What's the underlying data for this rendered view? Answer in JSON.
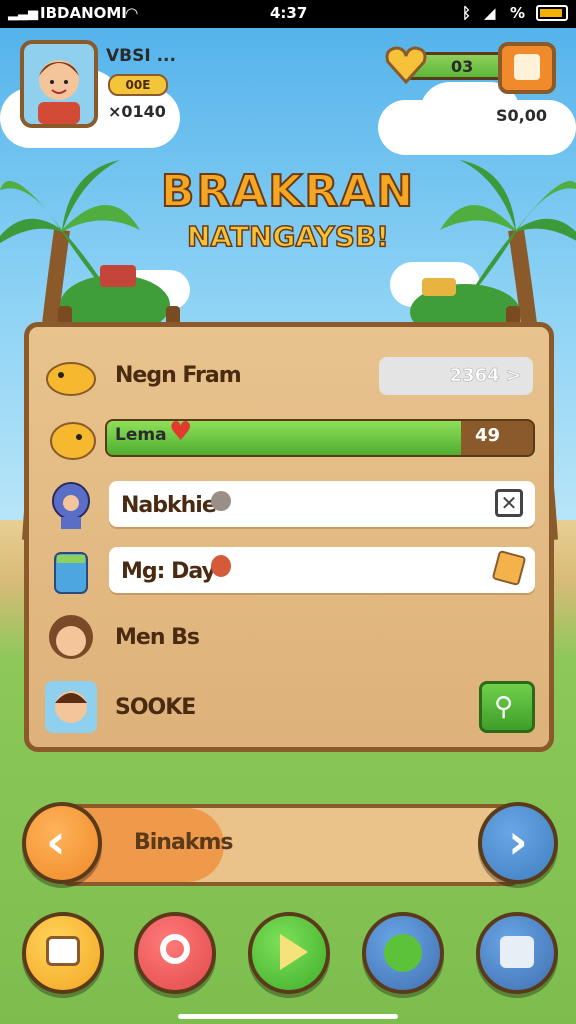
{
  "status_bar": {
    "carrier": "IBDANOMI",
    "time": "4:37",
    "battery_text": "%"
  },
  "player": {
    "name": "VBSI ...",
    "level": "00E",
    "coins": "×0140"
  },
  "currency": {
    "count": "03",
    "gold": "S0,00"
  },
  "title": {
    "line1": "BRAKRAN",
    "line2": "NATNGAYSB!"
  },
  "menu": {
    "row1": {
      "label": "Negn Fram",
      "value": "2364 >"
    },
    "row2": {
      "label": "Lema",
      "value": "49",
      "progress": 0.83
    },
    "row3": {
      "label": "Nabkhie"
    },
    "row4": {
      "label": "Mg: Day"
    },
    "row5": {
      "label": "Men Bs"
    },
    "row6": {
      "label": "SOOKE"
    }
  },
  "pager": {
    "label": "Binakms"
  },
  "colors": {
    "wood": "#deb27a",
    "green": "#5bb83a",
    "orange": "#f08a2a",
    "blue": "#3f7fc0"
  }
}
